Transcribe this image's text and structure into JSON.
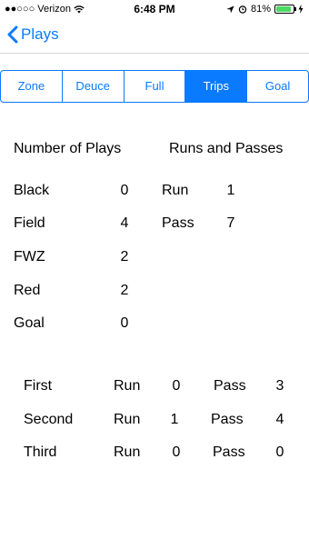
{
  "status": {
    "carrier": "●●○○○ Verizon",
    "time": "6:48 PM",
    "battery": "81%"
  },
  "nav": {
    "back_label": "Plays"
  },
  "segments": [
    "Zone",
    "Deuce",
    "Full",
    "Trips",
    "Goal"
  ],
  "selected_segment": "Trips",
  "headers": {
    "plays": "Number of Plays",
    "runs_passes": "Runs and Passes"
  },
  "plays": [
    {
      "label": "Black",
      "count": "0"
    },
    {
      "label": "Field",
      "count": "4"
    },
    {
      "label": "FWZ",
      "count": "2"
    },
    {
      "label": "Red",
      "count": "2"
    },
    {
      "label": "Goal",
      "count": "0"
    }
  ],
  "totals": [
    {
      "label": "Run",
      "count": "1"
    },
    {
      "label": "Pass",
      "count": "7"
    }
  ],
  "downs": [
    {
      "down": "First",
      "run_label": "Run",
      "run": "0",
      "pass_label": "Pass",
      "pass": "3"
    },
    {
      "down": "Second",
      "run_label": "Run",
      "run": "1",
      "pass_label": "Pass",
      "pass": "4"
    },
    {
      "down": "Third",
      "run_label": "Run",
      "run": "0",
      "pass_label": "Pass",
      "pass": "0"
    }
  ]
}
